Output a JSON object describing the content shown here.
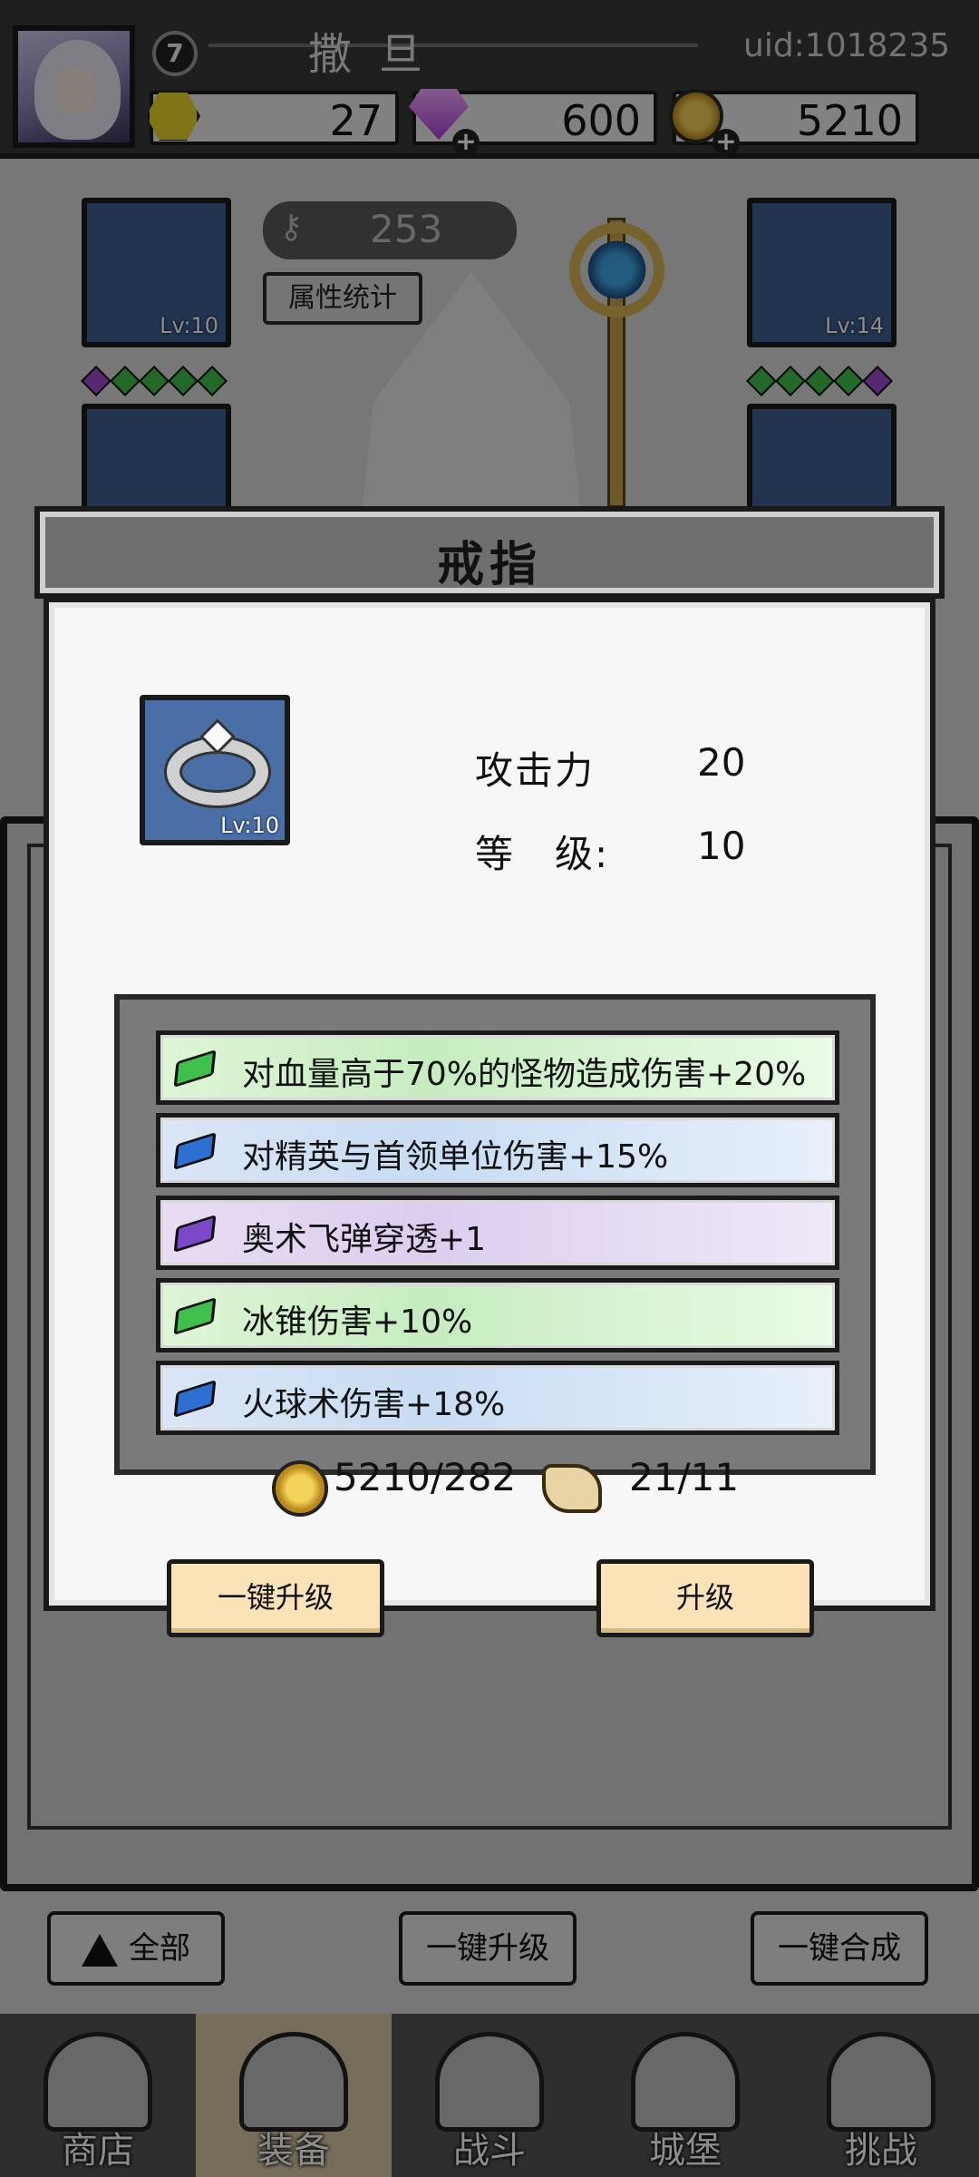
{
  "header": {
    "level": "7",
    "player_name": "撒旦",
    "uid": "uid:1018235",
    "resources": [
      {
        "icon": "yellow-hex-icon",
        "value": "27",
        "has_plus": false
      },
      {
        "icon": "purple-diamond-icon",
        "value": "600",
        "has_plus": true
      },
      {
        "icon": "gold-coin-icon",
        "value": "5210",
        "has_plus": true
      }
    ]
  },
  "character": {
    "power": "253",
    "stats_button": "属性统计",
    "slots": [
      {
        "name": "helmet",
        "level": "Lv:10"
      },
      {
        "name": "gloves",
        "level": "Lv:14"
      }
    ]
  },
  "modal": {
    "title": "戒指",
    "item_level": "Lv:10",
    "stats": [
      {
        "label": "攻击力",
        "value": "20"
      },
      {
        "label": "等　级:",
        "value": "10"
      }
    ],
    "affixes": [
      {
        "tier": "green",
        "text": "对血量高于70%的怪物造成伤害+20%"
      },
      {
        "tier": "blue",
        "text": "对精英与首领单位伤害+15%"
      },
      {
        "tier": "purple",
        "text": "奥术飞弹穿透+1"
      },
      {
        "tier": "green",
        "text": "冰锥伤害+10%"
      },
      {
        "tier": "blue",
        "text": "火球术伤害+18%"
      }
    ],
    "gold_cost": "5210/282",
    "scroll_cost": "21/11",
    "buttons": {
      "upgrade_all": "一键升级",
      "upgrade": "升级"
    }
  },
  "inventory_buttons": {
    "filter": "全部",
    "upgrade_all": "一键升级",
    "merge_all": "一键合成"
  },
  "tabs": [
    {
      "label": "商店",
      "active": false
    },
    {
      "label": "装备",
      "active": true
    },
    {
      "label": "战斗",
      "active": false
    },
    {
      "label": "城堡",
      "active": false
    },
    {
      "label": "挑战",
      "active": false
    }
  ],
  "colors": {
    "green": "#3fbf4c",
    "blue": "#2c6fd0",
    "purple": "#7b48c9",
    "button": "#fbe3b8"
  }
}
